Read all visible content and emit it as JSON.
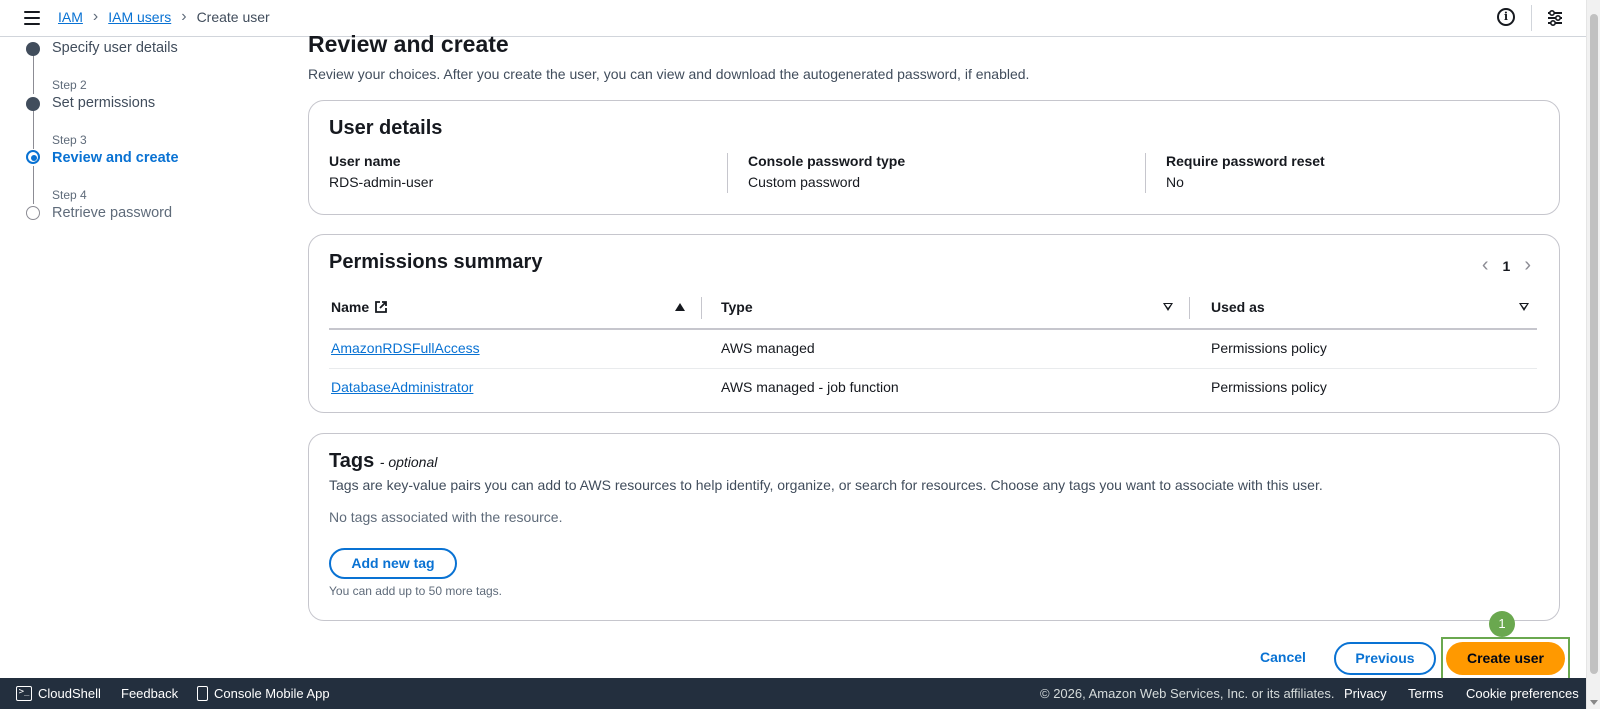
{
  "breadcrumb": {
    "items": [
      "IAM",
      "IAM users"
    ],
    "current": "Create user"
  },
  "stepper": {
    "step1_label": "Specify user details",
    "step2_small": "Step 2",
    "step2_label": "Set permissions",
    "step3_small": "Step 3",
    "step3_label": "Review and create",
    "step4_small": "Step 4",
    "step4_label": "Retrieve password"
  },
  "page": {
    "title": "Review and create",
    "description": "Review your choices. After you create the user, you can view and download the autogenerated password, if enabled."
  },
  "user_details": {
    "title": "User details",
    "fields": [
      {
        "key": "User name",
        "value": "RDS-admin-user"
      },
      {
        "key": "Console password type",
        "value": "Custom password"
      },
      {
        "key": "Require password reset",
        "value": "No"
      }
    ]
  },
  "permissions": {
    "title": "Permissions summary",
    "page": "1",
    "columns": [
      "Name",
      "Type",
      "Used as"
    ],
    "rows": [
      {
        "name": "AmazonRDSFullAccess",
        "type": "AWS managed",
        "used_as": "Permissions policy"
      },
      {
        "name": "DatabaseAdministrator",
        "type": "AWS managed - job function",
        "used_as": "Permissions policy"
      }
    ]
  },
  "tags": {
    "title": "Tags",
    "subtitle": "- optional",
    "description": "Tags are key-value pairs you can add to AWS resources to help identify, organize, or search for resources. Choose any tags you want to associate with this user.",
    "empty": "No tags associated with the resource.",
    "add_button": "Add new tag",
    "hint": "You can add up to 50 more tags."
  },
  "actions": {
    "cancel": "Cancel",
    "previous": "Previous",
    "create": "Create user",
    "badge": "1"
  },
  "footer": {
    "cloudshell": "CloudShell",
    "feedback": "Feedback",
    "mobile_app": "Console Mobile App",
    "copyright": "© 2026, Amazon Web Services, Inc. or its affiliates.",
    "privacy": "Privacy",
    "terms": "Terms",
    "cookies": "Cookie preferences"
  },
  "colors": {
    "link": "#0972d3",
    "primary_button": "#ff9900",
    "footer_bg": "#232f3e",
    "highlight": "#6aa84f"
  },
  "icons": [
    "menu-icon",
    "info-icon",
    "settings-icon",
    "external-link-icon",
    "sort-ascending-icon",
    "filter-caret-icon",
    "chevron-left-icon",
    "chevron-right-icon",
    "cloudshell-icon",
    "mobile-app-icon"
  ]
}
